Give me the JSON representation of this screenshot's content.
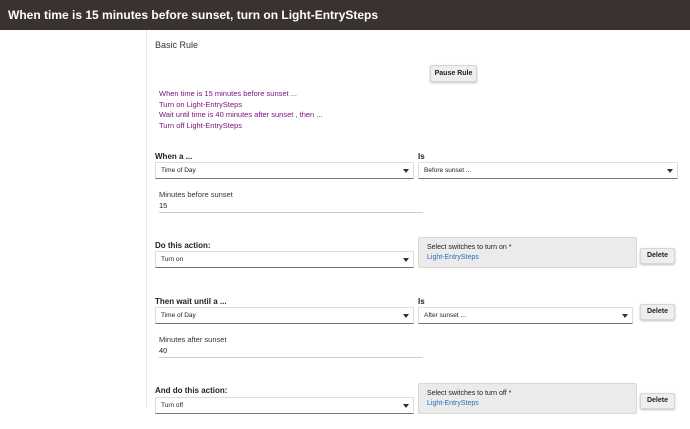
{
  "header": {
    "title": "When time is 15 minutes before sunset, turn on Light-EntrySteps"
  },
  "main": {
    "heading": "Basic Rule",
    "pause_button": "Pause Rule",
    "summary": [
      "When time is 15 minutes before sunset ...",
      "Turn on Light-EntrySteps",
      "Wait until time is 40 minutes after sunset , then ...",
      "Turn off Light-EntrySteps"
    ],
    "trigger": {
      "label": "When a ...",
      "type": "Time of Day",
      "is_label": "Is",
      "is_value": "Before sunset ...",
      "minutes_label": "Minutes before sunset",
      "minutes_value": "15"
    },
    "action1": {
      "label": "Do this action:",
      "value": "Turn on",
      "device_title": "Select switches to turn on *",
      "device": "Light-EntrySteps",
      "delete": "Delete"
    },
    "wait": {
      "label": "Then wait until a ...",
      "type": "Time of Day",
      "is_label": "Is",
      "is_value": "After sunset ...",
      "delete": "Delete",
      "minutes_label": "Minutes after sunset",
      "minutes_value": "40"
    },
    "action2": {
      "label": "And do this action:",
      "value": "Turn off",
      "device_title": "Select switches to turn off *",
      "device": "Light-EntrySteps",
      "delete": "Delete"
    }
  }
}
